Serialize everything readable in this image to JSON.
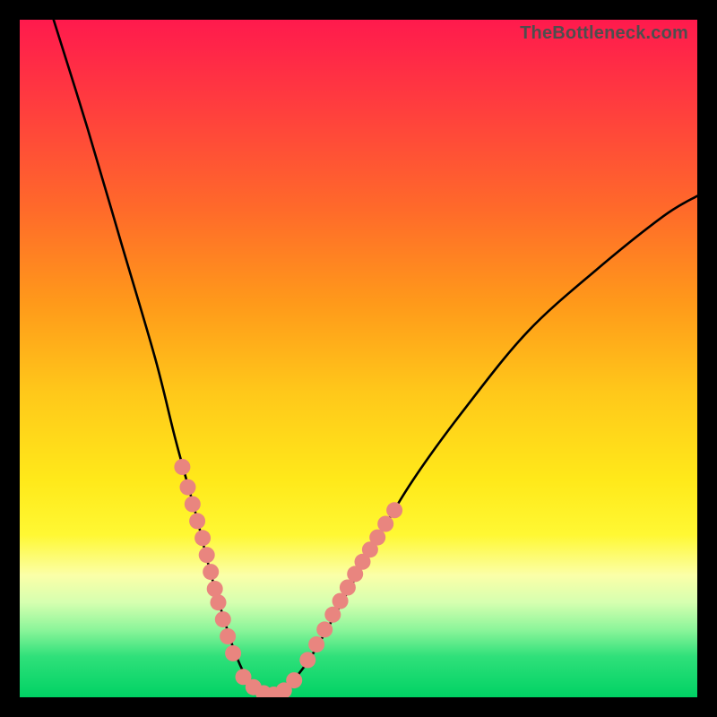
{
  "watermark": "TheBottleneck.com",
  "chart_data": {
    "type": "line",
    "title": "",
    "xlabel": "",
    "ylabel": "",
    "xlim": [
      0,
      100
    ],
    "ylim": [
      0,
      100
    ],
    "grid": false,
    "series": [
      {
        "name": "bottleneck-curve",
        "x": [
          5,
          10,
          15,
          20,
          23,
          26,
          28,
          30,
          32,
          34,
          36,
          38,
          40,
          43,
          47,
          52,
          58,
          66,
          75,
          85,
          95,
          100
        ],
        "y": [
          100,
          84,
          67,
          50,
          38,
          27,
          19,
          12,
          6,
          2,
          0,
          0,
          2,
          6,
          13,
          22,
          32,
          43,
          54,
          63,
          71,
          74
        ]
      }
    ],
    "marker_clusters": [
      {
        "name": "left-cluster",
        "points": [
          {
            "x": 24.0,
            "y": 34.0
          },
          {
            "x": 24.8,
            "y": 31.0
          },
          {
            "x": 25.5,
            "y": 28.5
          },
          {
            "x": 26.2,
            "y": 26.0
          },
          {
            "x": 27.0,
            "y": 23.5
          },
          {
            "x": 27.6,
            "y": 21.0
          },
          {
            "x": 28.2,
            "y": 18.5
          },
          {
            "x": 28.8,
            "y": 16.0
          },
          {
            "x": 29.3,
            "y": 14.0
          },
          {
            "x": 30.0,
            "y": 11.5
          },
          {
            "x": 30.7,
            "y": 9.0
          },
          {
            "x": 31.5,
            "y": 6.5
          }
        ]
      },
      {
        "name": "bottom-cluster",
        "points": [
          {
            "x": 33.0,
            "y": 3.0
          },
          {
            "x": 34.5,
            "y": 1.5
          },
          {
            "x": 36.0,
            "y": 0.6
          },
          {
            "x": 37.5,
            "y": 0.4
          },
          {
            "x": 39.0,
            "y": 1.0
          },
          {
            "x": 40.5,
            "y": 2.5
          }
        ]
      },
      {
        "name": "right-cluster",
        "points": [
          {
            "x": 42.5,
            "y": 5.5
          },
          {
            "x": 43.8,
            "y": 7.8
          },
          {
            "x": 45.0,
            "y": 10.0
          },
          {
            "x": 46.2,
            "y": 12.2
          },
          {
            "x": 47.3,
            "y": 14.2
          },
          {
            "x": 48.4,
            "y": 16.2
          },
          {
            "x": 49.5,
            "y": 18.2
          },
          {
            "x": 50.6,
            "y": 20.0
          },
          {
            "x": 51.7,
            "y": 21.8
          },
          {
            "x": 52.8,
            "y": 23.6
          },
          {
            "x": 54.0,
            "y": 25.6
          },
          {
            "x": 55.3,
            "y": 27.6
          }
        ]
      }
    ],
    "colors": {
      "curve": "#000000",
      "markers": "#e9857f",
      "background_top": "#ff1a4d",
      "background_bottom": "#00d264"
    }
  }
}
